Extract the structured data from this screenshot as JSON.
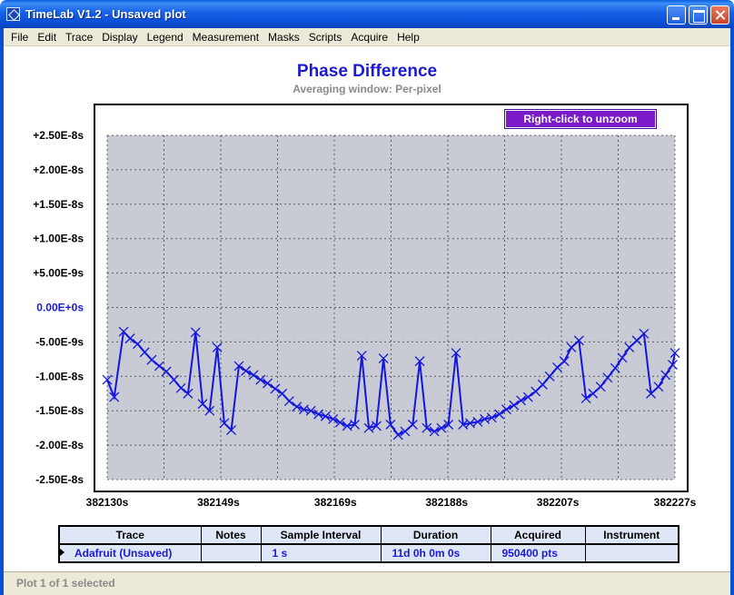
{
  "window": {
    "title": "TimeLab V1.2 - Unsaved plot"
  },
  "menu": [
    "File",
    "Edit",
    "Trace",
    "Display",
    "Legend",
    "Measurement",
    "Masks",
    "Scripts",
    "Acquire",
    "Help"
  ],
  "plot": {
    "title": "Phase Difference",
    "subtitle": "Averaging window: Per-pixel",
    "unzoom_label": "Right-click to unzoom"
  },
  "chart_data": {
    "type": "line",
    "title": "Phase Difference",
    "subtitle": "Averaging window: Per-pixel",
    "xlabel": "",
    "ylabel": "",
    "xlim": [
      382130,
      382227
    ],
    "ylim": [
      -2.5e-08,
      2.5e-08
    ],
    "grid": true,
    "y_ticks": [
      "+2.50E-8s",
      "+2.00E-8s",
      "+1.50E-8s",
      "+1.00E-8s",
      "+5.00E-9s",
      "0.00E+0s",
      "-5.00E-9s",
      "-1.00E-8s",
      "-1.50E-8s",
      "-2.00E-8s",
      "-2.50E-8s"
    ],
    "y_tick_values": [
      2.5e-08,
      2e-08,
      1.5e-08,
      1e-08,
      5e-09,
      0,
      -5e-09,
      -1e-08,
      -1.5e-08,
      -2e-08,
      -2.5e-08
    ],
    "x_ticks": [
      "382130s",
      "382149s",
      "382169s",
      "382188s",
      "382207s",
      "382227s"
    ],
    "x_tick_values": [
      382130,
      382149,
      382169,
      382188,
      382207,
      382227
    ],
    "series": [
      {
        "name": "Adafruit (Unsaved)",
        "color": "#1515e0",
        "x": [
          382130.0,
          382131.2,
          382132.8,
          382133.9,
          382135.2,
          382136.4,
          382137.6,
          382138.9,
          382140.1,
          382141.4,
          382142.6,
          382143.8,
          382145.1,
          382146.3,
          382147.5,
          382148.8,
          382150.0,
          382151.2,
          382152.5,
          382153.7,
          382155.0,
          382156.2,
          382157.4,
          382158.7,
          382159.9,
          382161.1,
          382162.4,
          382163.6,
          382164.8,
          382166.1,
          382167.3,
          382168.6,
          382169.8,
          382171.0,
          382172.3,
          382173.5,
          382174.7,
          382176.0,
          382177.2,
          382178.4,
          382179.7,
          382180.9,
          382182.2,
          382183.4,
          382184.6,
          382185.9,
          382187.1,
          382188.3,
          382189.6,
          382190.8,
          382192.0,
          382193.3,
          382194.5,
          382195.7,
          382197.0,
          382198.2,
          382199.5,
          382200.7,
          382201.9,
          382203.2,
          382204.4,
          382205.6,
          382206.9,
          382208.1,
          382209.3,
          382210.6,
          382211.8,
          382213.0,
          382214.3,
          382215.5,
          382216.8,
          382218.0,
          382219.2,
          382220.5,
          382221.7,
          382222.9,
          382224.2,
          382225.4,
          382226.6,
          382227.0
        ],
        "y": [
          -1.05e-08,
          -1.3e-08,
          -3.5e-09,
          -4.5e-09,
          -5.3e-09,
          -6.5e-09,
          -7.6e-09,
          -8.5e-09,
          -9.3e-09,
          -1.05e-08,
          -1.17e-08,
          -1.25e-08,
          -3.6e-09,
          -1.4e-08,
          -1.5e-08,
          -5.8e-09,
          -1.68e-08,
          -1.78e-08,
          -8.5e-09,
          -9.2e-09,
          -9.8e-09,
          -1.05e-08,
          -1.1e-08,
          -1.18e-08,
          -1.25e-08,
          -1.36e-08,
          -1.44e-08,
          -1.48e-08,
          -1.5e-08,
          -1.55e-08,
          -1.58e-08,
          -1.62e-08,
          -1.67e-08,
          -1.72e-08,
          -1.7e-08,
          -7e-09,
          -1.75e-08,
          -1.72e-08,
          -7.4e-09,
          -1.7e-08,
          -1.85e-08,
          -1.8e-08,
          -1.7e-08,
          -7.8e-09,
          -1.75e-08,
          -1.8e-08,
          -1.75e-08,
          -1.7e-08,
          -6.6e-09,
          -1.7e-08,
          -1.68e-08,
          -1.66e-08,
          -1.62e-08,
          -1.6e-08,
          -1.55e-08,
          -1.48e-08,
          -1.42e-08,
          -1.35e-08,
          -1.3e-08,
          -1.22e-08,
          -1.12e-08,
          -1e-08,
          -8.7e-09,
          -7.8e-09,
          -5.8e-09,
          -4.8e-09,
          -1.32e-08,
          -1.25e-08,
          -1.15e-08,
          -1.02e-08,
          -8.8e-09,
          -7.3e-09,
          -5.8e-09,
          -4.8e-09,
          -3.8e-09,
          -1.25e-08,
          -1.15e-08,
          -9.8e-09,
          -8.3e-09,
          -6.6e-09
        ]
      }
    ]
  },
  "trace_table": {
    "headers": [
      "Trace",
      "Notes",
      "Sample Interval",
      "Duration",
      "Acquired",
      "Instrument"
    ],
    "rows": [
      [
        "Adafruit (Unsaved)",
        "",
        "1 s",
        "11d 0h 0m 0s",
        "950400 pts",
        ""
      ]
    ]
  },
  "status": {
    "text": "Plot 1 of 1 selected"
  },
  "colors": {
    "title_bar": "#0b4fd6",
    "plot_title": "#1a1ad8",
    "trace": "#1515e0",
    "plot_background": "#c8cbd4",
    "unzoom_button": "#7a1ac8",
    "table_background": "#dfe6f6"
  }
}
